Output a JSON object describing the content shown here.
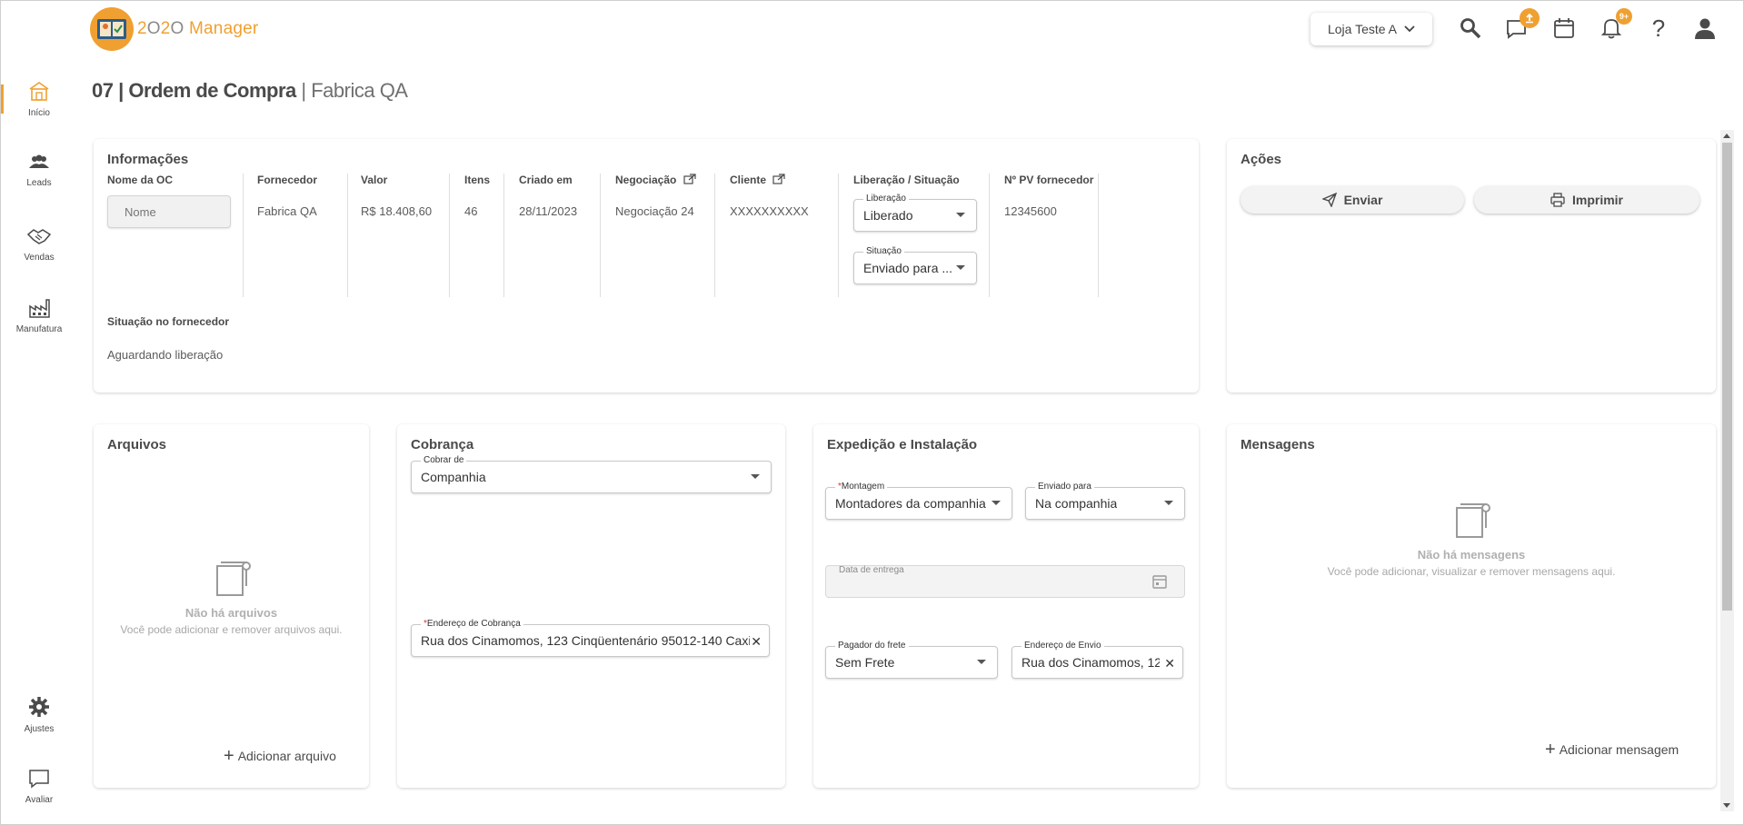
{
  "app": {
    "logo_text_a": "2",
    "logo_text_b": "O",
    "logo_text_c": "2",
    "logo_text_d": "O",
    "logo_name": " Manager"
  },
  "sidebar": {
    "items": [
      {
        "label": "Início"
      },
      {
        "label": "Leads"
      },
      {
        "label": "Vendas"
      },
      {
        "label": "Manufatura"
      },
      {
        "label": "Ajustes"
      },
      {
        "label": "Avaliar"
      }
    ]
  },
  "header": {
    "store_label": "Loja Teste A",
    "messages_badge": "",
    "notifications_badge": "9+",
    "help_label": "?"
  },
  "page": {
    "title_main": "07 | Ordem de Compra",
    "title_sub": " | Fabrica QA"
  },
  "info": {
    "title": "Informações",
    "columns": {
      "nome_oc_label": "Nome da OC",
      "nome_oc_placeholder": "Nome",
      "fornecedor_label": "Fornecedor",
      "fornecedor_value": "Fabrica QA",
      "valor_label": "Valor",
      "valor_value": "R$ 18.408,60",
      "itens_label": "Itens",
      "itens_value": "46",
      "criado_label": "Criado em",
      "criado_value": "28/11/2023",
      "negociacao_label": "Negociação",
      "negociacao_value": "Negociação 24",
      "cliente_label": "Cliente",
      "cliente_value": "XXXXXXXXXX",
      "liberacao_situacao_label": "Liberação / Situação",
      "liberacao_field_label": "Liberação",
      "liberacao_value": "Liberado",
      "situacao_field_label": "Situação",
      "situacao_value": "Enviado para ...",
      "pv_label": "Nº PV fornecedor",
      "pv_value": "12345600"
    },
    "situacao_fornecedor_label": "Situação no fornecedor",
    "situacao_fornecedor_value": "Aguardando liberação"
  },
  "actions": {
    "title": "Ações",
    "send_label": "Enviar",
    "print_label": "Imprimir"
  },
  "files": {
    "title": "Arquivos",
    "empty_title": "Não há arquivos",
    "empty_sub": "Você pode adicionar e remover arquivos aqui.",
    "add_label": "Adicionar arquivo"
  },
  "billing": {
    "title": "Cobrança",
    "charge_from_label": "Cobrar de",
    "charge_from_value": "Companhia",
    "address_label": "Endereço de Cobrança",
    "address_value": "Rua dos Cinamomos, 123 Cinqüentenário 95012-140 Caxi"
  },
  "shipping": {
    "title": "Expedição e Instalação",
    "montagem_label": "Montagem",
    "montagem_value": "Montadores da companhia",
    "enviado_label": "Enviado para",
    "enviado_value": "Na companhia",
    "delivery_label": "Data de entrega",
    "payer_label": "Pagador do frete",
    "payer_value": "Sem Frete",
    "ship_address_label": "Endereço de Envio",
    "ship_address_value": "Rua dos Cinamomos, 12"
  },
  "messages": {
    "title": "Mensagens",
    "empty_title": "Não há mensagens",
    "empty_sub": "Você pode adicionar, visualizar e remover mensagens aqui.",
    "add_label": "Adicionar mensagem"
  },
  "colors": {
    "accent": "#f0a030",
    "text": "#4a4a4a",
    "muted": "#b0b0b0"
  }
}
